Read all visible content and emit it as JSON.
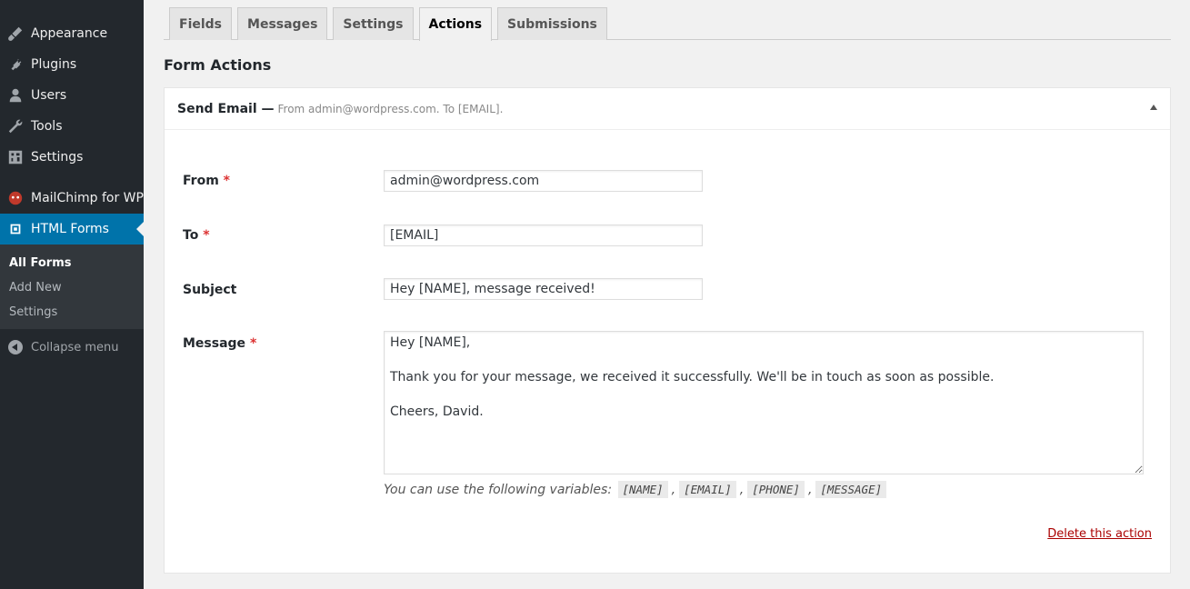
{
  "sidebar": {
    "items": [
      {
        "label": "Appearance",
        "icon": "brush-icon"
      },
      {
        "label": "Plugins",
        "icon": "plug-icon"
      },
      {
        "label": "Users",
        "icon": "user-icon"
      },
      {
        "label": "Tools",
        "icon": "wrench-icon"
      },
      {
        "label": "Settings",
        "icon": "settings-icon"
      },
      {
        "label": "MailChimp for WP",
        "icon": "mailchimp-icon"
      },
      {
        "label": "HTML Forms",
        "icon": "forms-icon"
      }
    ],
    "submenu": [
      "All Forms",
      "Add New",
      "Settings"
    ],
    "collapse_label": "Collapse menu"
  },
  "tabs": [
    "Fields",
    "Messages",
    "Settings",
    "Actions",
    "Submissions"
  ],
  "active_tab": "Actions",
  "page_title": "Form Actions",
  "action": {
    "title": "Send Email —",
    "summary": "From admin@wordpress.com. To [EMAIL].",
    "from_label": "From",
    "from_value": "admin@wordpress.com",
    "to_label": "To",
    "to_value": "[EMAIL]",
    "subject_label": "Subject",
    "subject_value": "Hey [NAME], message received!",
    "message_label": "Message",
    "message_value": "Hey [NAME],\n\nThank you for your message, we received it successfully. We'll be in touch as soon as possible.\n\nCheers, David.",
    "required_marker": "*",
    "vars_hint": "You can use the following variables:",
    "variables": [
      "[NAME]",
      "[EMAIL]",
      "[PHONE]",
      "[MESSAGE]"
    ],
    "separator": ",",
    "delete_label": "Delete this action"
  },
  "colors": {
    "sidebar_bg": "#23282d",
    "accent": "#0073aa",
    "required": "#dc3232",
    "delete_link": "#a00000"
  }
}
